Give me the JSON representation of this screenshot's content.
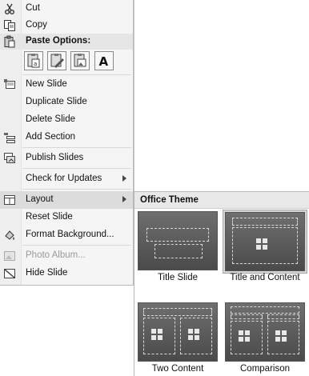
{
  "menu": {
    "items": [
      {
        "label": "Cut",
        "icon": "scissors-icon"
      },
      {
        "label": "Copy",
        "icon": "copy-icon"
      },
      {
        "label": "Paste Options:",
        "icon": "paste-icon"
      },
      {
        "label": "New Slide",
        "icon": "new-slide-icon"
      },
      {
        "label": "Duplicate Slide"
      },
      {
        "label": "Delete Slide"
      },
      {
        "label": "Add Section",
        "icon": "add-section-icon"
      },
      {
        "label": "Publish Slides",
        "icon": "publish-slides-icon"
      },
      {
        "label": "Check for Updates"
      },
      {
        "label": "Layout",
        "icon": "layout-icon"
      },
      {
        "label": "Reset Slide"
      },
      {
        "label": "Format Background...",
        "icon": "format-background-icon"
      },
      {
        "label": "Photo Album...",
        "icon": "photo-album-icon",
        "disabled": true
      },
      {
        "label": "Hide Slide",
        "icon": "hide-slide-icon"
      }
    ],
    "paste_buttons": [
      "use-destination-theme",
      "keep-source-formatting",
      "picture",
      "keep-text-only"
    ],
    "paste_text_glyph": "A"
  },
  "gallery": {
    "title": "Office Theme",
    "layouts": [
      {
        "label": "Title Slide"
      },
      {
        "label": "Title and Content",
        "selected": true
      },
      {
        "label": "Two Content"
      },
      {
        "label": "Comparison"
      }
    ]
  }
}
